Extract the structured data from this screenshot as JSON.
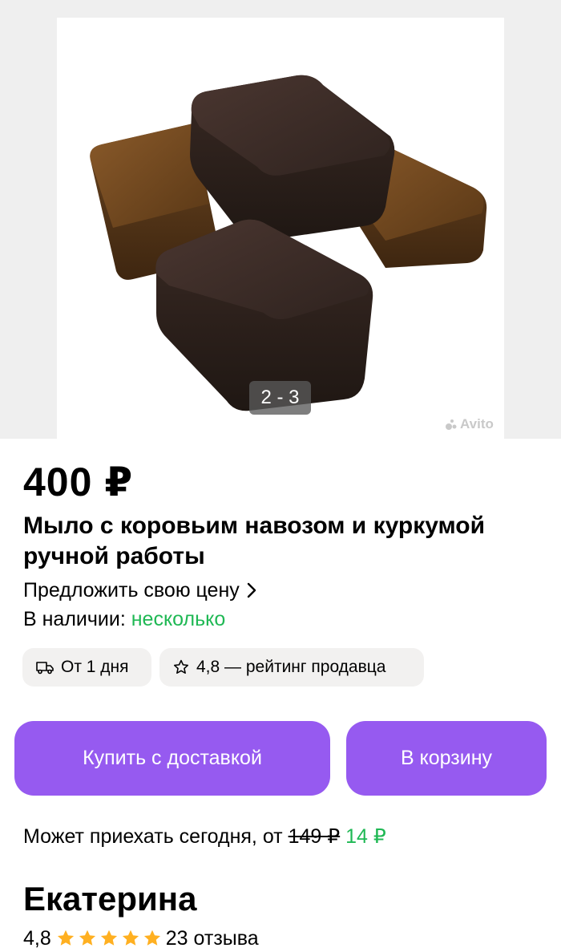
{
  "gallery": {
    "counter": "2 - 3",
    "watermark": "Avito"
  },
  "listing": {
    "price": "400 ₽",
    "title": "Мыло с коровьим навозом и куркумой ручной работы",
    "offer_price_label": "Предложить свою цену",
    "stock_label": "В наличии: ",
    "stock_value": "несколько"
  },
  "chips": {
    "delivery": "От 1 дня",
    "rating": "4,8 — рейтинг продавца"
  },
  "buttons": {
    "buy_with_delivery": "Купить с доставкой",
    "add_to_cart": "В корзину"
  },
  "delivery": {
    "text": "Может приехать сегодня, от ",
    "old_price": "149 ₽",
    "new_price": "14 ₽"
  },
  "seller": {
    "name": "Екатерина",
    "rating": "4,8",
    "stars": 5,
    "reviews": "23 отзыва"
  },
  "colors": {
    "accent_purple": "#965af0",
    "in_stock_green": "#1fb854",
    "star_yellow": "#ffb021",
    "chip_bg": "#f2f1f0"
  },
  "icons": {
    "offer_chevron": "chevron-right-icon",
    "delivery": "truck-icon",
    "rating": "star-outline-icon",
    "seller_stars": "star-filled-icon"
  }
}
